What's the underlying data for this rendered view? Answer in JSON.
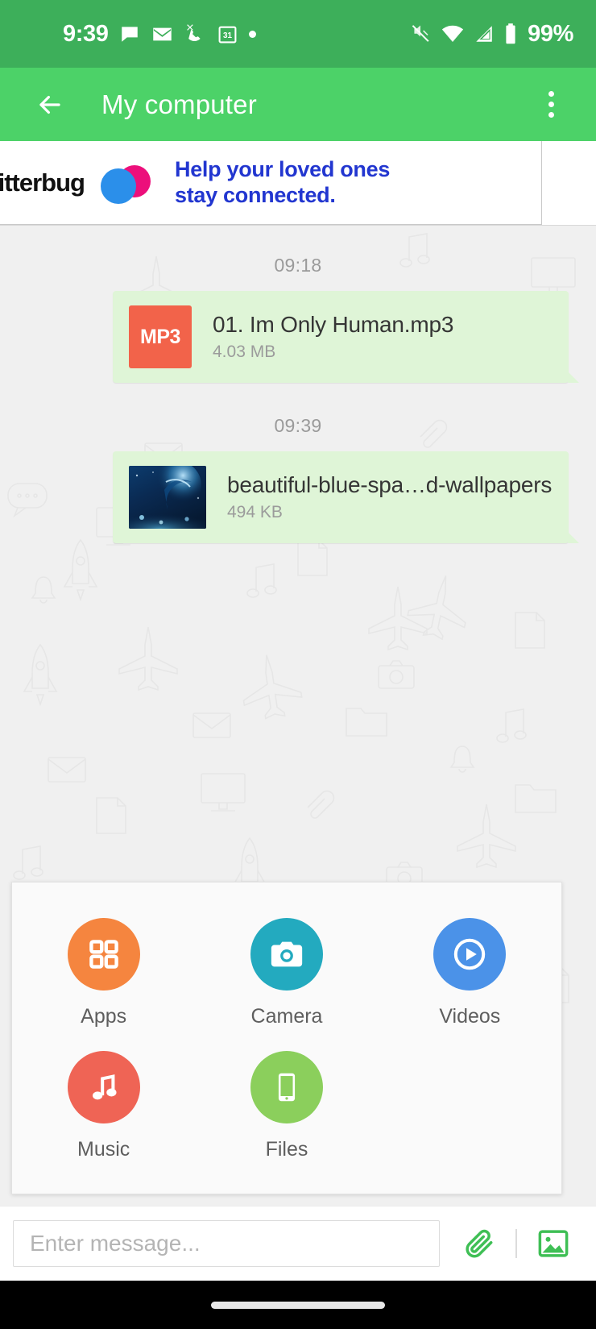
{
  "status_bar": {
    "clock": "9:39",
    "battery_percent": "99%",
    "left_icons": [
      "chat-bubble-icon",
      "envelope-icon",
      "missed-call-icon",
      "calendar-icon",
      "dot-indicator-icon"
    ],
    "calendar_day": "31",
    "right_icons": [
      "vibrate-off-icon",
      "wifi-icon",
      "cellular-signal-icon",
      "battery-icon"
    ],
    "background_color": "#3DAF5A"
  },
  "app_bar": {
    "title": "My computer",
    "back_icon": "arrow-left-icon",
    "overflow_icon": "more-vertical-icon",
    "background_color": "#4CD268"
  },
  "ad_banner": {
    "brand": "jitterbug",
    "headline_line1": "Help your loved ones",
    "headline_line2": "stay connected.",
    "text_color": "#2236D0",
    "dot_blue": "#2B8FEA",
    "dot_pink": "#EC0F7B"
  },
  "chat": {
    "background_color": "#F0F0F0",
    "bubble_color": "#DFF5D7",
    "messages": [
      {
        "timestamp": "09:18",
        "icon": "mp3-file-icon",
        "icon_label": "MP3",
        "icon_color": "#F2634A",
        "file_name": "01. Im Only Human.mp3",
        "file_size": "4.03 MB"
      },
      {
        "timestamp": "09:39",
        "icon": "image-thumbnail",
        "icon_label": "",
        "icon_color": "#081a30",
        "file_name": "beautiful-blue-spa…d-wallpapers.jpg",
        "file_size": "494 KB"
      }
    ]
  },
  "attachment_sheet": {
    "items": [
      {
        "label": "Apps",
        "icon": "grid-apps-icon",
        "color": "#F5853F"
      },
      {
        "label": "Camera",
        "icon": "camera-icon",
        "color": "#23AABF"
      },
      {
        "label": "Videos",
        "icon": "play-circle-icon",
        "color": "#4B92E8"
      },
      {
        "label": "Music",
        "icon": "music-note-icon",
        "color": "#EF6455"
      },
      {
        "label": "Files",
        "icon": "device-phone-icon",
        "color": "#8BCF5C"
      }
    ]
  },
  "input_bar": {
    "placeholder": "Enter message...",
    "value": "",
    "attach_icon": "paperclip-icon",
    "gallery_icon": "image-gallery-icon",
    "icon_color": "#3FBF55"
  },
  "nav_bar": {
    "home_indicator": "home-indicator"
  }
}
